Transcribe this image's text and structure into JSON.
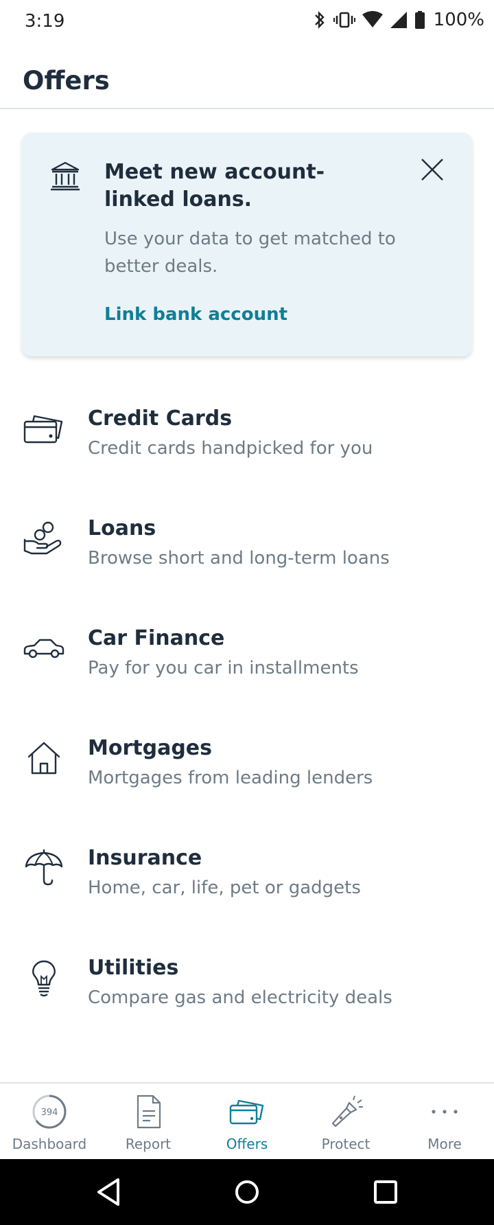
{
  "status_bar": {
    "time": "3:19",
    "battery": "100%"
  },
  "header": {
    "title": "Offers"
  },
  "promo": {
    "title": "Meet new account-linked loans.",
    "body": "Use your data to get matched to better deals.",
    "link": "Link bank account"
  },
  "offers": [
    {
      "title": "Credit Cards",
      "description": "Credit cards handpicked for you",
      "icon": "credit-card-icon"
    },
    {
      "title": "Loans",
      "description": "Browse short and long-term loans",
      "icon": "hand-coins-icon"
    },
    {
      "title": "Car Finance",
      "description": "Pay for you car in installments",
      "icon": "car-icon"
    },
    {
      "title": "Mortgages",
      "description": "Mortgages from leading lenders",
      "icon": "house-icon"
    },
    {
      "title": "Insurance",
      "description": "Home, car, life, pet or gadgets",
      "icon": "umbrella-icon"
    },
    {
      "title": "Utilities",
      "description": "Compare gas and electricity deals",
      "icon": "lightbulb-icon"
    }
  ],
  "bottom_nav": {
    "score": "394",
    "items": [
      {
        "label": "Dashboard",
        "icon": "score-gauge-icon"
      },
      {
        "label": "Report",
        "icon": "document-icon"
      },
      {
        "label": "Offers",
        "icon": "credit-card-icon",
        "active": true
      },
      {
        "label": "Protect",
        "icon": "flashlight-icon"
      },
      {
        "label": "More",
        "icon": "more-dots-icon"
      }
    ]
  },
  "colors": {
    "accent": "#117e97",
    "text_primary": "#1f2d3d",
    "text_secondary": "#6d7b86",
    "promo_bg": "#eaf4f8"
  }
}
